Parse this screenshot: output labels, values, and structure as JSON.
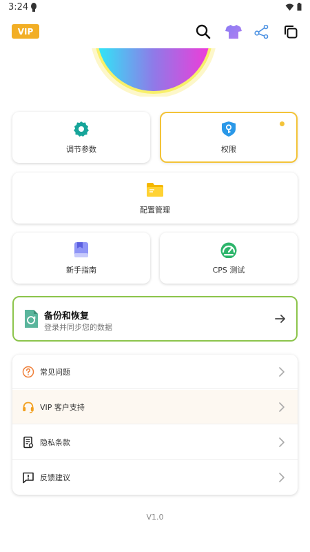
{
  "status_bar": {
    "time": "3:24"
  },
  "header": {
    "vip_label": "VIP"
  },
  "grid": {
    "params_label": "调节参数",
    "permissions_label": "权限",
    "config_label": "配置管理",
    "guide_label": "新手指南",
    "cps_label": "CPS 测试"
  },
  "backup": {
    "title": "备份和恢复",
    "subtitle": "登录并同步您的数据"
  },
  "menu": {
    "faq": "常见问题",
    "vip_support": "VIP 客户支持",
    "privacy": "隐私条款",
    "feedback": "反馈建议"
  },
  "version": "V1.0",
  "colors": {
    "vip": "#f2ae25",
    "teal": "#17a59a",
    "active_border": "#f3c338",
    "backup_border": "#8cc44b"
  }
}
